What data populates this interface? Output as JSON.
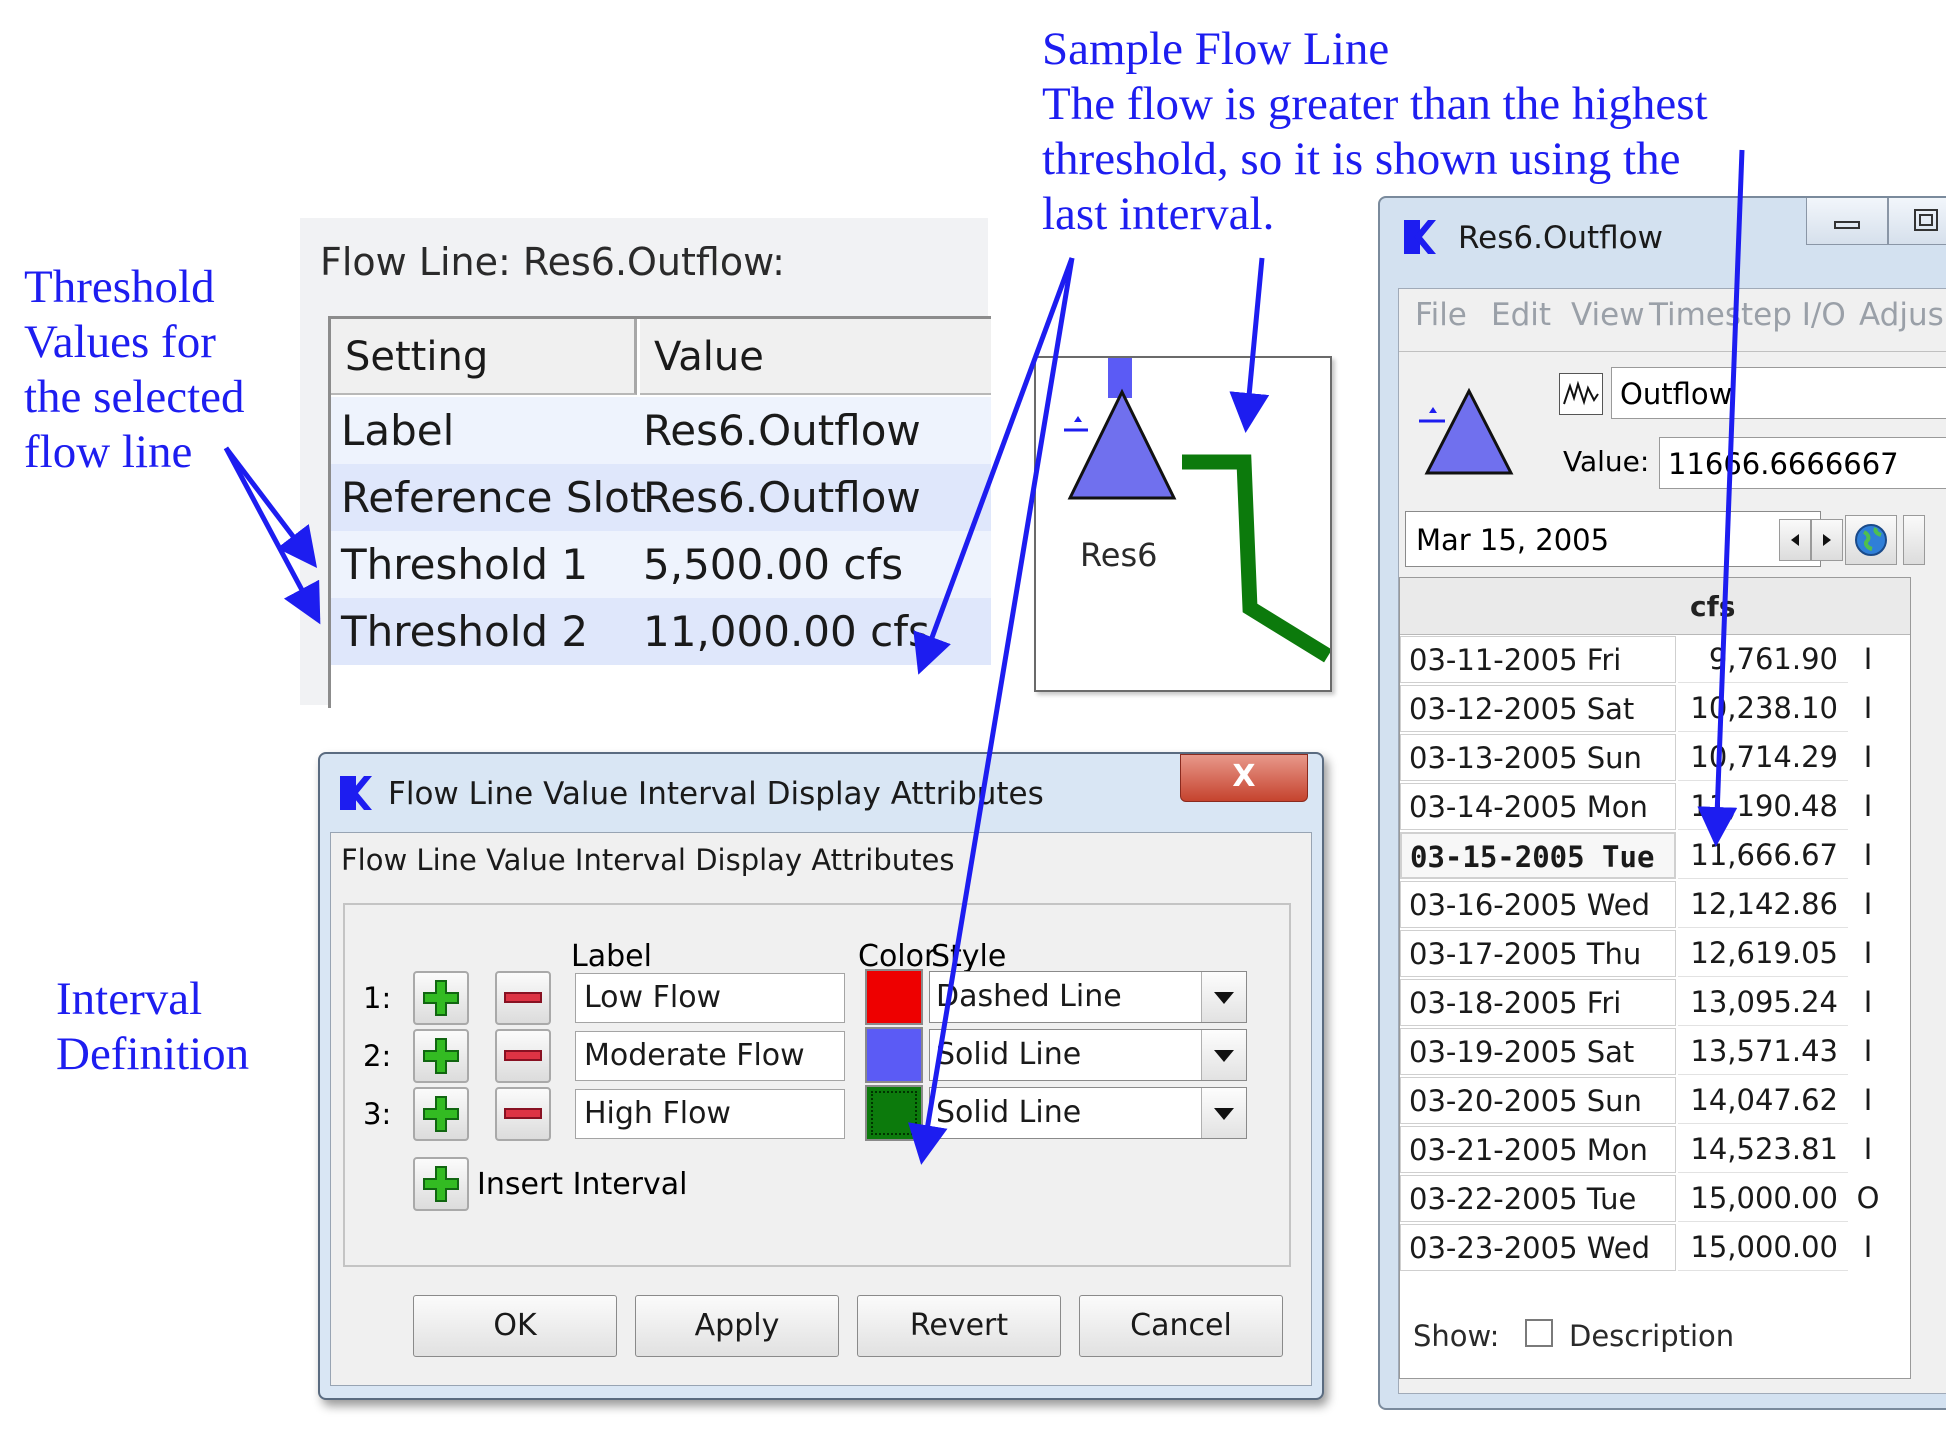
{
  "annotations": {
    "sample_flow_line": [
      "Sample Flow Line",
      "The flow is greater than the highest",
      "threshold, so it is shown using the",
      "last interval."
    ],
    "threshold_values": [
      "Threshold",
      "Values for",
      "the selected",
      "flow line"
    ],
    "interval_definition": [
      "Interval",
      "Definition"
    ]
  },
  "settings_panel": {
    "title": "Flow Line: Res6.Outflow:",
    "headers": [
      "Setting",
      "Value"
    ],
    "rows": [
      {
        "setting": "Label",
        "value": "Res6.Outflow"
      },
      {
        "setting": "Reference Slot",
        "value": "Res6.Outflow"
      },
      {
        "setting": "Threshold 1",
        "value": "5,500.00 cfs"
      },
      {
        "setting": "Threshold 2",
        "value": "11,000.00 cfs"
      }
    ]
  },
  "map_view": {
    "reservoir_label": "Res6"
  },
  "interval_dialog": {
    "title": "Flow Line Value Interval Display Attributes",
    "group_title": "Flow Line Value Interval Display Attributes",
    "column_headers": {
      "label": "Label",
      "color": "Color",
      "style": "Style"
    },
    "intervals": [
      {
        "index": "1:",
        "label": "Low Flow",
        "color": "#ee0000",
        "style": "Dashed Line"
      },
      {
        "index": "2:",
        "label": "Moderate Flow",
        "color": "#5b5bf5",
        "style": "Solid Line"
      },
      {
        "index": "3:",
        "label": "High Flow",
        "color": "#0c7a0c",
        "style": "Solid Line"
      }
    ],
    "insert_label": "Insert Interval",
    "buttons": {
      "ok": "OK",
      "apply": "Apply",
      "revert": "Revert",
      "cancel": "Cancel"
    },
    "close_glyph": "X"
  },
  "slot_window": {
    "title": "Res6.Outflow",
    "menu": [
      "File",
      "Edit",
      "View",
      "Timestep I/O",
      "Adjus"
    ],
    "slot_name": "Outflow",
    "value_label": "Value:",
    "value": "11666.6666667",
    "date": "Mar 15, 2005",
    "column_header": "cfs",
    "rows": [
      {
        "date": "03-11-2005 Fri",
        "value": "9,761.90",
        "flag": "I"
      },
      {
        "date": "03-12-2005 Sat",
        "value": "10,238.10",
        "flag": "I"
      },
      {
        "date": "03-13-2005 Sun",
        "value": "10,714.29",
        "flag": "I"
      },
      {
        "date": "03-14-2005 Mon",
        "value": "11,190.48",
        "flag": "I"
      },
      {
        "date": "03-15-2005 Tue",
        "value": "11,666.67",
        "flag": "I"
      },
      {
        "date": "03-16-2005 Wed",
        "value": "12,142.86",
        "flag": "I"
      },
      {
        "date": "03-17-2005 Thu",
        "value": "12,619.05",
        "flag": "I"
      },
      {
        "date": "03-18-2005 Fri",
        "value": "13,095.24",
        "flag": "I"
      },
      {
        "date": "03-19-2005 Sat",
        "value": "13,571.43",
        "flag": "I"
      },
      {
        "date": "03-20-2005 Sun",
        "value": "14,047.62",
        "flag": "I"
      },
      {
        "date": "03-21-2005 Mon",
        "value": "14,523.81",
        "flag": "I"
      },
      {
        "date": "03-22-2005 Tue",
        "value": "15,000.00",
        "flag": "O"
      },
      {
        "date": "03-23-2005 Wed",
        "value": "15,000.00",
        "flag": "I"
      }
    ],
    "show_label": "Show:",
    "description_label": "Description"
  }
}
